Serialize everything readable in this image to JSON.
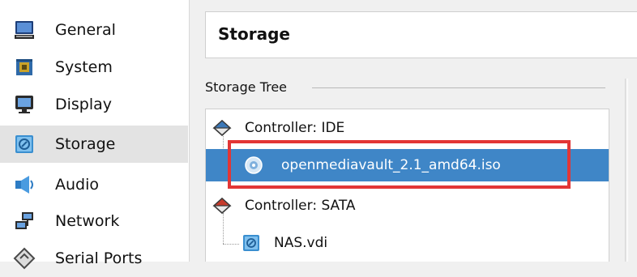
{
  "sidebar": {
    "items": [
      {
        "label": "General",
        "icon": "monitor-icon"
      },
      {
        "label": "System",
        "icon": "chip-icon"
      },
      {
        "label": "Display",
        "icon": "display-icon"
      },
      {
        "label": "Storage",
        "icon": "storage-icon",
        "selected": true
      },
      {
        "label": "Audio",
        "icon": "speaker-icon"
      },
      {
        "label": "Network",
        "icon": "network-icon"
      },
      {
        "label": "Serial Ports",
        "icon": "serial-port-icon"
      }
    ]
  },
  "main": {
    "title": "Storage",
    "storage_tree": {
      "label": "Storage Tree",
      "nodes": [
        {
          "label": "Controller: IDE",
          "icon": "ide-controller-icon"
        },
        {
          "label": "openmediavault_2.1_amd64.iso",
          "icon": "optical-disc-icon",
          "selected": true,
          "highlighted": true
        },
        {
          "label": "Controller: SATA",
          "icon": "sata-controller-icon"
        },
        {
          "label": "NAS.vdi",
          "icon": "hard-disk-icon"
        }
      ]
    }
  },
  "colors": {
    "selection": "#3f86c7",
    "highlight_border": "#e23636",
    "sidebar_selected": "#e3e3e3"
  }
}
